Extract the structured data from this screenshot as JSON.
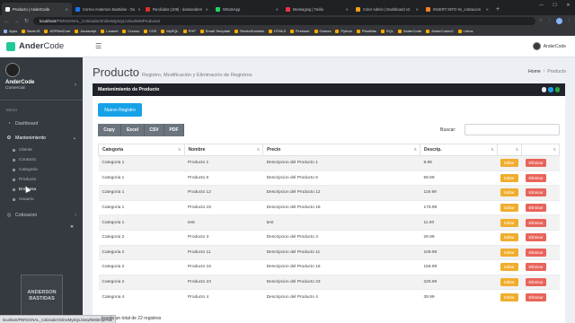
{
  "browser": {
    "tabs": [
      {
        "title": "Producto | AnderCode",
        "active": true,
        "color": "#ffffff"
      },
      {
        "title": "Correo Anderson Bastidas - Ou",
        "active": false,
        "color": "#1a73e8"
      },
      {
        "title": "Recibidos (109) - dansanders",
        "active": false,
        "color": "#d93025"
      },
      {
        "title": "WhatsApp",
        "active": false,
        "color": "#25d366"
      },
      {
        "title": "Messaging | Twilio",
        "active": false,
        "color": "#f22f46"
      },
      {
        "title": "Color Admin | Dashboard v2",
        "active": false,
        "color": "#f59c1a"
      },
      {
        "title": "INSERT INTO tm_cotizacion",
        "active": false,
        "color": "#f48024"
      }
    ],
    "url_host": "localhost",
    "url_path": "/PERSONAL_CotizadorOnlineMySQL/view/MntProducto/",
    "bookmarks": [
      "Apps",
      "NodeJS",
      "ASPNetCore",
      "Javascript",
      "Laravel",
      "Cursos",
      "CSS",
      "MySQL",
      "PHP",
      "Email Template",
      "RedesSociales",
      "HTML5",
      "Firebase",
      "Games",
      "Python",
      "Plantillas",
      "SQL",
      "AnderCode",
      "AnderCodev2",
      "Libros"
    ]
  },
  "header": {
    "logo_bold": "Ander",
    "logo_rest": "Code",
    "user_name": "AnderCode"
  },
  "sidebar": {
    "user_name": "AnderCode",
    "user_role": "Comercial",
    "menu_header": "Menu",
    "items": [
      {
        "label": "Dashboard",
        "icon": "tachometer-icon"
      },
      {
        "label": "Mantenimiento",
        "icon": "gear-icon"
      }
    ],
    "sub_items": [
      "Cliente",
      "Contacto",
      "Categoria",
      "Producto",
      "Empresa",
      "Usuario"
    ],
    "cotizacion": "Cotizacion",
    "watermark": "ANDERSON BASTIDAS"
  },
  "page": {
    "title": "Producto",
    "subtitle": "Registro, Modificación y Eliminación de Registros",
    "breadcrumb_home": "Home",
    "breadcrumb_current": "Producto"
  },
  "card": {
    "title": "Mantenimiento de Producto",
    "new_button": "Nuevo Registro",
    "exports": [
      "Copy",
      "Excel",
      "CSV",
      "PDF"
    ],
    "search_label": "Buscar:"
  },
  "table": {
    "headers": [
      "Categoria",
      "Nombre",
      "Precio",
      "Descrip.",
      "",
      ""
    ],
    "rows": [
      [
        "Categoria 1",
        "Producto 1",
        "Descripcion del Producto 1",
        "9.99"
      ],
      [
        "Categoria 1",
        "Producto 6",
        "Descripcion del Producto 6",
        "59.99"
      ],
      [
        "Categoria 1",
        "Producto 12",
        "Descripcion del Producto 12",
        "119.99"
      ],
      [
        "Categoria 1",
        "Producto 18",
        "Descripcion del Producto 18",
        "179.99"
      ],
      [
        "Categoria 1",
        "test",
        "test",
        "11.00"
      ],
      [
        "Categoria 2",
        "Producto 3",
        "Descripcion del Producto 3",
        "29.99"
      ],
      [
        "Categoria 2",
        "Producto 11",
        "Descripcion del Producto 11",
        "109.99"
      ],
      [
        "Categoria 2",
        "Producto 16",
        "Descripcion del Producto 16",
        "159.99"
      ],
      [
        "Categoria 2",
        "Producto 23",
        "Descripcion del Producto 23",
        "229.99"
      ],
      [
        "Categoria 4",
        "Producto 4",
        "Descripcion del Producto 4",
        "39.99"
      ]
    ],
    "edit_label": "Editar",
    "delete_label": "Eliminar"
  },
  "footer": {
    "status_url": "localhost/PERSONAL_CotizadorOnlineMySQL/view/MntEmpresa/",
    "info": "trando un total de 22 registros"
  },
  "colors": {
    "accent": "#17a2e8",
    "edit": "#f0ad2c",
    "delete": "#e8645a",
    "sidebar": "#343a40",
    "card_header": "#20232a"
  }
}
